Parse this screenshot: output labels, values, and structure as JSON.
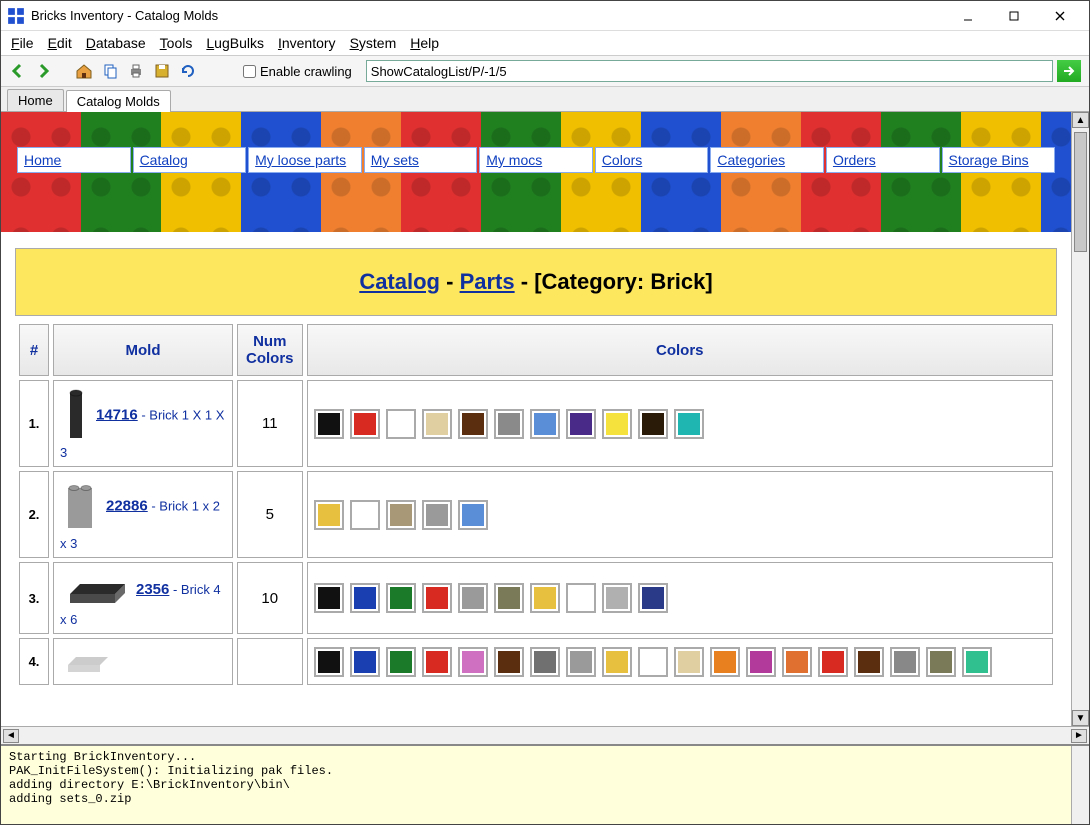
{
  "window": {
    "title": "Bricks Inventory - Catalog Molds"
  },
  "menu": [
    "File",
    "Edit",
    "Database",
    "Tools",
    "LugBulks",
    "Inventory",
    "System",
    "Help"
  ],
  "toolbar": {
    "enable_crawling_label": "Enable crawling",
    "url_value": "ShowCatalogList/P/-1/5"
  },
  "tabs": [
    {
      "label": "Home",
      "active": false
    },
    {
      "label": "Catalog Molds",
      "active": true
    }
  ],
  "nav": [
    "Home",
    "Catalog",
    "My loose parts",
    "My sets",
    "My mocs",
    "Colors",
    "Categories",
    "Orders",
    "Storage Bins"
  ],
  "breadcrumb": {
    "catalog": "Catalog",
    "parts": "Parts",
    "category_prefix": " - [Category: ",
    "category": "Brick",
    "suffix": "]"
  },
  "table": {
    "headers": {
      "idx": "#",
      "mold": "Mold",
      "num": "Num Colors",
      "colors": "Colors"
    },
    "rows": [
      {
        "idx": "1.",
        "part_id": "14716",
        "desc": " - Brick 1 X 1 X 3",
        "num": "11",
        "brick_color": "#2a2a2a",
        "brick_shape": "tall",
        "colors": [
          "#111111",
          "#d82a20",
          "#ffffff",
          "#e0cfa0",
          "#5a2e0e",
          "#8a8a8a",
          "#5a8fd8",
          "#4a2a88",
          "#f5e23c",
          "#2a1a08",
          "#1fb5b0"
        ]
      },
      {
        "idx": "2.",
        "part_id": "22886",
        "desc": " - Brick 1 x 2 x 3",
        "num": "5",
        "brick_color": "#9a9a9a",
        "brick_shape": "med",
        "colors": [
          "#e8c040",
          "#ffffff",
          "#a89878",
          "#9a9a9a",
          "#5a8fd8"
        ]
      },
      {
        "idx": "3.",
        "part_id": "2356",
        "desc": " - Brick 4 x 6",
        "num": "10",
        "brick_color": "#2a2a2a",
        "brick_shape": "flat",
        "colors": [
          "#111111",
          "#1a3fb0",
          "#1a7a2a",
          "#d82a20",
          "#9a9a9a",
          "#7a7a58",
          "#e8c040",
          "#ffffff",
          "#b0b0b0",
          "#2a3a88"
        ]
      },
      {
        "idx": "4.",
        "part_id": "",
        "desc": "",
        "num": "",
        "brick_color": "#cccccc",
        "brick_shape": "low",
        "colors": [
          "#111111",
          "#1a3fb0",
          "#1a7a2a",
          "#d82a20",
          "#d070c0",
          "#5a2e0e",
          "#707070",
          "#9a9a9a",
          "#e8c040",
          "#ffffff",
          "#e0cfa0",
          "#e88020",
          "#b23a9a",
          "#e07030",
          "#d82a20",
          "#5a2e0e",
          "#888888",
          "#7a7a58",
          "#30c090"
        ]
      }
    ]
  },
  "log": "Starting BrickInventory...\nPAK_InitFileSystem(): Initializing pak files.\nadding directory E:\\BrickInventory\\bin\\\nadding sets_0.zip"
}
